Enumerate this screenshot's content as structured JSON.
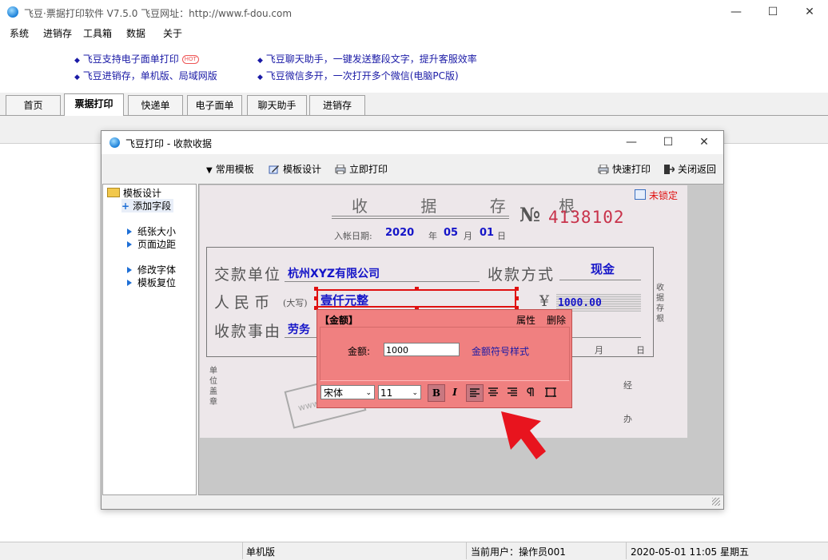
{
  "window": {
    "title": "飞豆·票据打印软件 V7.5.0   飞豆网址：http://www.f-dou.com",
    "controls": {
      "minimize": "—",
      "maximize": "☐",
      "close": "✕"
    }
  },
  "menu": [
    "系统",
    "进销存",
    "工具箱",
    "数据",
    "关于"
  ],
  "promo": {
    "left": [
      "飞豆支持电子面单打印",
      "飞豆进销存，单机版、局域网版"
    ],
    "right": [
      "飞豆聊天助手，一键发送整段文字，提升客服效率",
      "飞豆微信多开，一次打开多个微信(电脑PC版)"
    ],
    "hot": "HOT"
  },
  "tabs": [
    {
      "label": "首页"
    },
    {
      "label": "票据打印"
    },
    {
      "label": "快递单"
    },
    {
      "label": "电子面单"
    },
    {
      "label": "聊天助手"
    },
    {
      "label": "进销存"
    }
  ],
  "dialog": {
    "title": "飞豆打印 - 收款收据",
    "toolbar": {
      "templates": "常用模板",
      "design": "模板设计",
      "print_now": "立即打印",
      "quick_print": "快速打印",
      "close_return": "关闭返回"
    },
    "tree": {
      "root": "模板设计",
      "add_field": "添加字段",
      "items": [
        "纸张大小",
        "页面边距",
        "修改字体",
        "模板复位"
      ]
    },
    "lock": "未锁定",
    "receipt": {
      "title": "收 据 存 根",
      "no_prefix": "№",
      "number": "4138102",
      "date_label": "入帐日期:",
      "year": "2020",
      "month": "05",
      "day": "01",
      "year_unit": "年",
      "month_unit": "月",
      "day_unit": "日",
      "payer_label": "交款单位",
      "payer": "杭州XYZ有限公司",
      "method_label": "收款方式",
      "method": "现金",
      "rmb_label": "人 民 币",
      "uppercase_note": "(大写)",
      "amount_words": "壹仟元整",
      "yen": "¥",
      "amount": "1000.00",
      "reason_label": "收款事由",
      "reason": "劳务",
      "side_text": "收据存根",
      "seal_label": "单位盖章",
      "handled_label": "经办",
      "bottom_month": "月",
      "bottom_day": "日",
      "watermark": "www.f-dou"
    },
    "popup": {
      "title": "【金额】",
      "properties": "属性",
      "delete": "删除",
      "amount_label": "金额:",
      "amount_value": "1000",
      "symbol_style": "金额符号样式",
      "font": "宋体",
      "size": "11",
      "bold": "B",
      "italic": "I"
    }
  },
  "status": {
    "edition": "单机版",
    "user": "当前用户：操作员001",
    "datetime": "2020-05-01 11:05 星期五"
  },
  "colors": {
    "accent_blue": "#1515c8",
    "number_red": "#c8324a",
    "popup_bg": "#f08080",
    "selection_red": "#e01010",
    "arrow_red": "#e8141e"
  }
}
